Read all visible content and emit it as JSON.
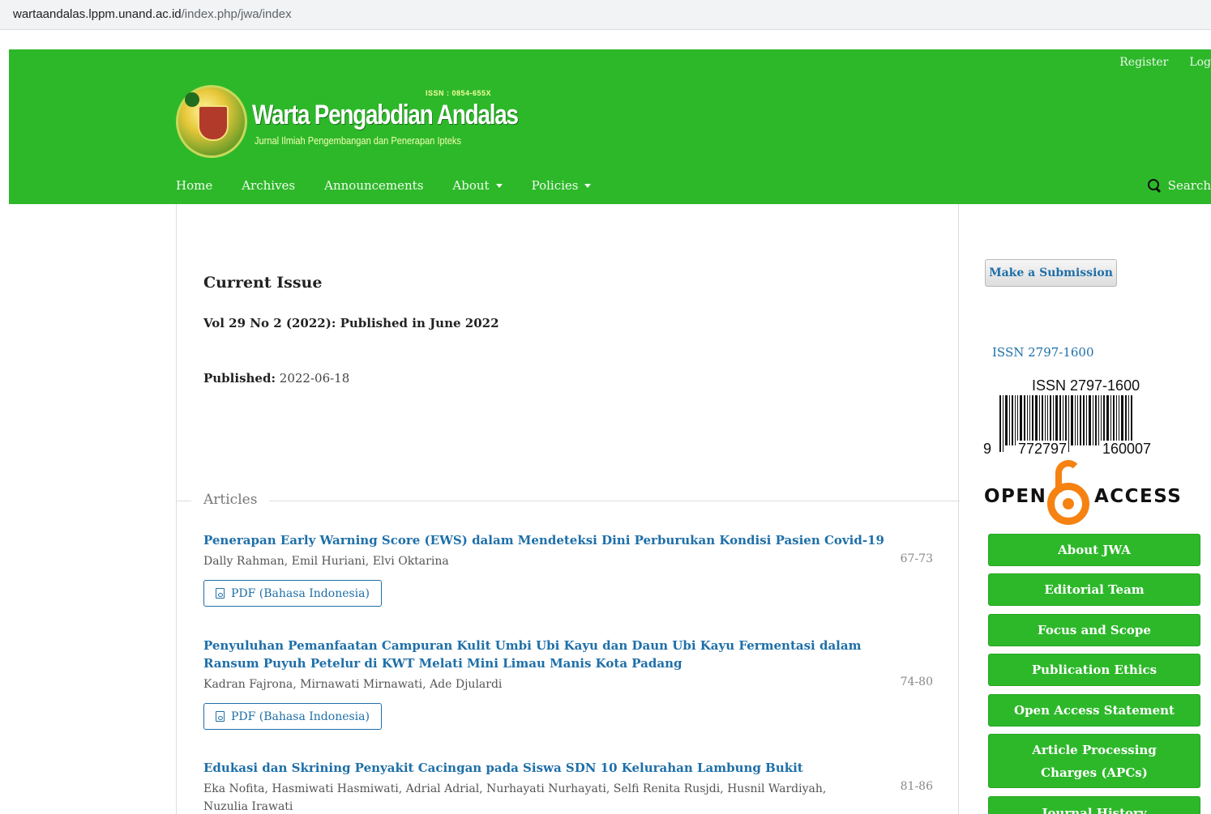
{
  "browser": {
    "url_host": "wartaandalas.lppm.unand.ac.id",
    "url_path": "/index.php/jwa/index"
  },
  "header": {
    "user_nav": [
      "Register",
      "Log"
    ],
    "logo": {
      "issn": "ISSN : 0854-655X",
      "title": "Warta Pengabdian Andalas",
      "subtitle": "Jurnal Ilmiah Pengembangan dan Penerapan Ipteks"
    },
    "nav": {
      "home": "Home",
      "archives": "Archives",
      "announcements": "Announcements",
      "about": "About",
      "policies": "Policies"
    },
    "search_label": "Search"
  },
  "main": {
    "heading": "Current Issue",
    "issue_title": "Vol 29 No 2 (2022): Published in June 2022",
    "published_label": "Published:",
    "published_date": "2022-06-18",
    "articles_label": "Articles",
    "articles": [
      {
        "title": "Penerapan Early Warning Score (EWS) dalam Mendeteksi Dini Perburukan Kondisi Pasien Covid-19",
        "authors": "Dally Rahman, Emil Huriani, Elvi Oktarina",
        "pages": "67-73",
        "pdf_label": "PDF (Bahasa Indonesia)"
      },
      {
        "title": "Penyuluhan Pemanfaatan Campuran Kulit Umbi Ubi Kayu dan Daun Ubi Kayu Fermentasi dalam Ransum Puyuh Petelur di KWT Melati Mini Limau Manis Kota Padang",
        "authors": "Kadran Fajrona, Mirnawati Mirnawati, Ade Djulardi",
        "pages": "74-80",
        "pdf_label": "PDF (Bahasa Indonesia)"
      },
      {
        "title": "Edukasi dan Skrining Penyakit Cacingan pada Siswa SDN 10 Kelurahan Lambung Bukit",
        "authors": "Eka Nofita, Hasmiwati Hasmiwati, Adrial Adrial, Nurhayati Nurhayati, Selfi Renita Rusjdi, Husnil Wardiyah, Nuzulia Irawati",
        "pages": "81-86"
      }
    ]
  },
  "sidebar": {
    "submit_label": "Make a Submission",
    "issn_link": "ISSN 2797-1600",
    "barcode": {
      "top": "ISSN 2797-1600",
      "left_digit": "9",
      "group1": "772797",
      "group2": "160007"
    },
    "open_access": {
      "open": "OPEN",
      "access": "ACCESS"
    },
    "buttons": [
      "About JWA",
      "Editorial Team",
      "Focus and Scope",
      "Publication Ethics",
      "Open Access Statement",
      "Article Processing Charges (APCs)",
      "Journal History"
    ]
  },
  "colors": {
    "header_green": "#2db82a",
    "link_blue": "#1e6fa8",
    "oa_orange": "#f68212"
  }
}
